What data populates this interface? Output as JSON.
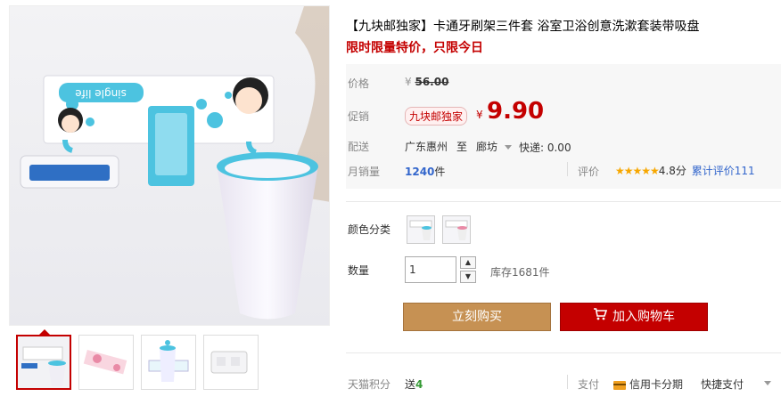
{
  "product": {
    "title": "【九块邮独家】卡通牙刷架三件套 浴室卫浴创意洗漱套装带吸盘",
    "subtitle": "限时限量特价，只限今日"
  },
  "price": {
    "label": "价格",
    "currency": "¥",
    "original": "56.00"
  },
  "promo": {
    "label": "促销",
    "tag": "九块邮独家",
    "currency": "¥",
    "price": "9.90"
  },
  "shipping": {
    "label": "配送",
    "from": "广东惠州",
    "to_word": "至",
    "to": "廊坊",
    "fee": "快递: 0.00"
  },
  "sales": {
    "label": "月销量",
    "count": "1240",
    "unit": "件",
    "rating_label": "评价",
    "stars": "★★★★★",
    "score": "4.8分",
    "total_reviews": "累计评价111"
  },
  "color": {
    "label": "颜色分类"
  },
  "quantity": {
    "label": "数量",
    "value": "1",
    "stock": "库存1681件"
  },
  "buttons": {
    "buy_now": "立刻购买",
    "add_cart": "加入购物车"
  },
  "footer": {
    "points_label": "天猫积分",
    "points_value_prefix": "送",
    "points_value": "4",
    "pay_label": "支付",
    "credit": "信用卡分期",
    "quick_pay": "快捷支付"
  },
  "image": {
    "brand_text": "single life"
  },
  "colors": {
    "accent_red": "#c40000",
    "buy_gold": "#c69153",
    "link_blue": "#3366cc",
    "cup_blue": "#4cc3e0"
  }
}
